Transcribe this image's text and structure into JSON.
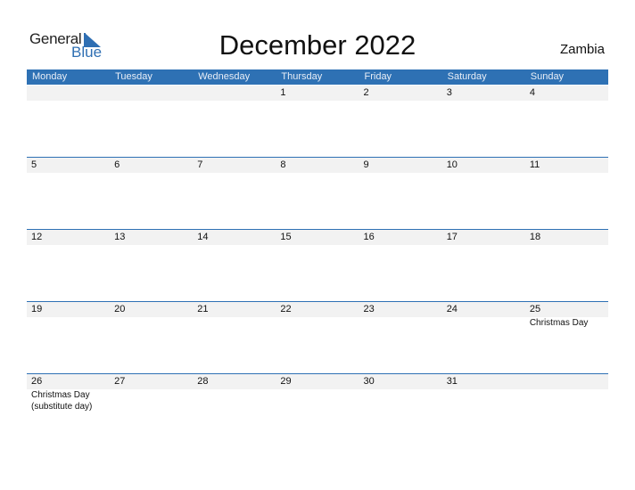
{
  "logo": {
    "word1": "General",
    "word2": "Blue"
  },
  "title": "December 2022",
  "country": "Zambia",
  "colors": {
    "accent": "#2e71b4",
    "row_strip": "#f2f2f2"
  },
  "weekdays": [
    "Monday",
    "Tuesday",
    "Wednesday",
    "Thursday",
    "Friday",
    "Saturday",
    "Sunday"
  ],
  "weeks": [
    [
      {
        "day": ""
      },
      {
        "day": ""
      },
      {
        "day": ""
      },
      {
        "day": "1"
      },
      {
        "day": "2"
      },
      {
        "day": "3"
      },
      {
        "day": "4"
      }
    ],
    [
      {
        "day": "5"
      },
      {
        "day": "6"
      },
      {
        "day": "7"
      },
      {
        "day": "8"
      },
      {
        "day": "9"
      },
      {
        "day": "10"
      },
      {
        "day": "11"
      }
    ],
    [
      {
        "day": "12"
      },
      {
        "day": "13"
      },
      {
        "day": "14"
      },
      {
        "day": "15"
      },
      {
        "day": "16"
      },
      {
        "day": "17"
      },
      {
        "day": "18"
      }
    ],
    [
      {
        "day": "19"
      },
      {
        "day": "20"
      },
      {
        "day": "21"
      },
      {
        "day": "22"
      },
      {
        "day": "23"
      },
      {
        "day": "24"
      },
      {
        "day": "25",
        "events": [
          "Christmas Day"
        ]
      }
    ],
    [
      {
        "day": "26",
        "events": [
          "Christmas Day",
          "(substitute day)"
        ]
      },
      {
        "day": "27"
      },
      {
        "day": "28"
      },
      {
        "day": "29"
      },
      {
        "day": "30"
      },
      {
        "day": "31"
      },
      {
        "day": ""
      }
    ]
  ]
}
